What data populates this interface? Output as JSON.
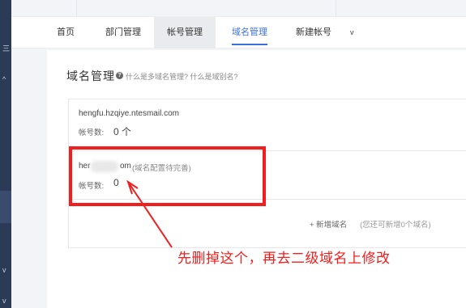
{
  "sidebar": {
    "marks": [
      "三",
      "^",
      "v",
      "v"
    ]
  },
  "nav": {
    "tabs": [
      {
        "label": "首页"
      },
      {
        "label": "部门管理"
      },
      {
        "label": "帐号管理"
      },
      {
        "label": "域名管理"
      },
      {
        "label": "新建帐号"
      }
    ],
    "caret": "v"
  },
  "page": {
    "title": "域名管理",
    "help_icon_glyph": "?",
    "help_text": "什么是多域名管理? 什么是域别名?"
  },
  "domains": [
    {
      "name": "hengfu.hzqiye.ntesmail.com",
      "count_label": "帐号数:",
      "count_value": "0 个"
    },
    {
      "name_start": "her",
      "name_end": "om",
      "status": "(域名配置待完善)",
      "count_label": "帐号数:",
      "count_value": "0"
    }
  ],
  "add_domain": {
    "label": "+ 新增域名",
    "hint": "(您还可新增0个域名)"
  },
  "annotation": {
    "text": "先删掉这个，再去二级域名上修改",
    "color": "#f21d1d"
  },
  "colors": {
    "accent": "#3b6fd8",
    "sidebar": "#2b3a55",
    "annotation_red": "#f21d1d"
  }
}
